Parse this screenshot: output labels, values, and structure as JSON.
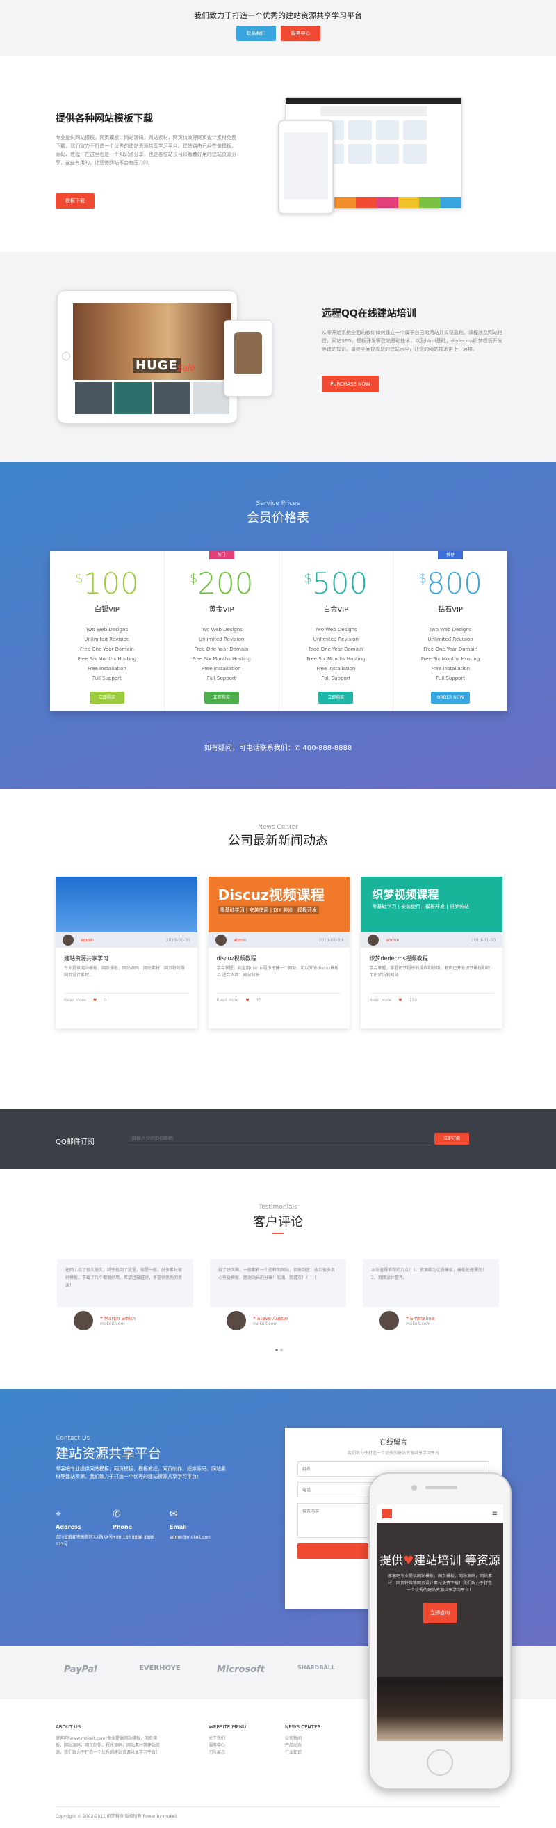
{
  "hero": {
    "tagline": "我们致力于打造一个优秀的建站资源共享学习平台",
    "btn_primary": "联系我们",
    "btn_secondary": "服务中心"
  },
  "template_section": {
    "title": "提供各种网站模板下载",
    "desc": "专业提供网站模板，网页模板，网站源码，网站素材，网页特效等网页设计素材免费下载。我们致力于打造一个优秀的建站资源共享学习平台。建站路由已经在做模板、源码、教程！在这里也是一个知识点分享，也是各位站长可以看着好用的建站资源分享，这些有用的，让您做网站不会有压力的。",
    "button": "模板下载"
  },
  "training_section": {
    "title": "远程QQ在线建站培训",
    "desc": "从零开始系统全面的教你如何建立一个属于自己的网站并实现盈利。课程涉及网站搭建，网站SEO，模板开发等建站基础技术。以及html基础，dedecms织梦模板开发等建站知识。最终全面提高您的建站水平，让您的网站技术更上一层楼。",
    "button": "PURCHASE NOW",
    "banner_big": "HUGE",
    "banner_small": "Sale"
  },
  "pricing": {
    "subtitle": "Service Prices",
    "title": "会员价格表",
    "currency": "$",
    "plans": [
      {
        "tag": "",
        "amount": "100",
        "name": "白银VIP",
        "features": [
          "Two Web Designs",
          "Unlimited Revision",
          "Free One Year Domain",
          "Free Six Months Hosting",
          "Free Installation",
          "Full Support"
        ],
        "button": "立即购买"
      },
      {
        "tag": "热门",
        "amount": "200",
        "name": "黄金VIP",
        "features": [
          "Two Web Designs",
          "Unlimited Revision",
          "Free One Year Domain",
          "Free Six Months Hosting",
          "Free Installation",
          "Full Support"
        ],
        "button": "立即购买"
      },
      {
        "tag": "",
        "amount": "500",
        "name": "白金VIP",
        "features": [
          "Two Web Designs",
          "Unlimited Revision",
          "Free One Year Domain",
          "Free Six Months Hosting",
          "Free Installation",
          "Full Support"
        ],
        "button": "立即购买"
      },
      {
        "tag": "推荐",
        "amount": "800",
        "name": "钻石VIP",
        "features": [
          "Two Web Designs",
          "Unlimited Revision",
          "Free One Year Domain",
          "Free Six Months Hosting",
          "Free Installation",
          "Full Support"
        ],
        "button": "ORDER NOW"
      }
    ],
    "contact": "如有疑问，可电话联系我们：✆ 400-888-8888"
  },
  "news": {
    "subtitle": "News Center",
    "title": "公司最新新闻动态",
    "items": [
      {
        "author": "admin",
        "date": "2019-01-30",
        "title": "建站资源共享学习",
        "excerpt": "专业提供网站模板，网页模板，网站源码，网站素材，网页特效等网页设计素材...",
        "read": "Read More",
        "likes": "0"
      },
      {
        "author": "admin",
        "date": "2019-01-30",
        "title": "discuz视频教程",
        "excerpt": "学会掌握，能运用discuz程序搭建一个网站，可以开发discuz模板且 适合人群：网站站长",
        "read": "Read More",
        "likes": "15",
        "img_label": "Discuz视频课程",
        "img_sub": "零基础学习 | 安装使用 | DIY 装修 | 模板开发"
      },
      {
        "author": "admin",
        "date": "2019-01-30",
        "title": "织梦dedecms视频教程",
        "excerpt": "学会掌握，掌握织梦程序的操作和使用，能自己开发织梦模板和使用织梦仿制网站",
        "read": "Read More",
        "likes": "159",
        "img_label": "织梦视频课程",
        "img_sub": "零基础学习 | 安装使用 | 模板开发 | 织梦仿站"
      }
    ]
  },
  "subscribe": {
    "label": "QQ邮件订阅",
    "placeholder": "请输入你的QQ邮箱",
    "button": "立即订阅"
  },
  "testimonials": {
    "subtitle": "Testimonials",
    "title": "客户评论",
    "items": [
      {
        "text": "在网上找了很久很久，终于找到了这里，很是一般，好多素材很好模板，下载了几个都很好用。希望越做越好，多提供优质的资源！",
        "name": "Martin Smith",
        "site": "mokeit.com"
      },
      {
        "text": "找了好久啊，一般都有一个这样的网站，但来到这，收到很多真心有益模板，感谢站长的分享！加油，我喜欢！！！！",
        "name": "Steve Austin",
        "site": "mokeit.com"
      },
      {
        "text": "本站值得推荐的几点！1、资源都为优质模板，模板处理漂亮！2、页面设计整齐。",
        "name": "Emmeline",
        "site": "mokeit.com"
      }
    ]
  },
  "contact": {
    "subtitle": "Contact Us",
    "title": "建站资源共享平台",
    "desc": "摩客吧专业提供网站模板，网页模板，模板教程，网页制作，程序源码，网站素材等建站资源。我们致力于打造一个优秀的建站资源共享学习平台！",
    "address_label": "Address",
    "address": "四川省成都市高新区XX路XX号123号",
    "phone_label": "Phone",
    "phone": "+86 186 8888 8888",
    "email_label": "Email",
    "email": "admin@mokeit.com",
    "form_title": "在线留言",
    "form_sub": "我们致力于打造一个优秀的建站资源共享学习平台",
    "form_name": "姓名",
    "form_phone": "电话",
    "form_msg": "留言内容",
    "form_send": "发送留言"
  },
  "phone_mock": {
    "headline_a": "提供",
    "heart": "♥",
    "headline_b": "建站培训 等资源",
    "desc": "摩客吧专业提供网站模板，网页模板，网站源码，网站素材，网页特效等网页设计素材免费下载！我们致力于打造一个优秀的建站资源共享学习平台！",
    "button": "立即咨询"
  },
  "partners": [
    "PayPal",
    "EVERHOYE",
    "Microsoft",
    "SHARDBALL"
  ],
  "footer": {
    "cols": [
      {
        "heading": "ABOUT US",
        "lines": [
          "摩客吧(www.mokeit.com)专业提供网站模板，网页模板，网站源码，网页制作，程序源码，网站素材等建站资源。我们致力于打造一个优秀的建站资源共享学习平台！"
        ]
      },
      {
        "heading": "WEBSITE MENU",
        "lines": [
          "关于我们",
          "服务中心",
          "团队展示"
        ]
      },
      {
        "heading": "NEWS CENTER",
        "lines": [
          "公司新闻",
          "产品动态",
          "行业知识"
        ]
      }
    ],
    "copyright": "Copyright © 2002-2011 织梦科技 版权所有 Power by mokeit"
  },
  "colors": {
    "accent": "#f04a33",
    "blue": "#3aa6e0"
  }
}
